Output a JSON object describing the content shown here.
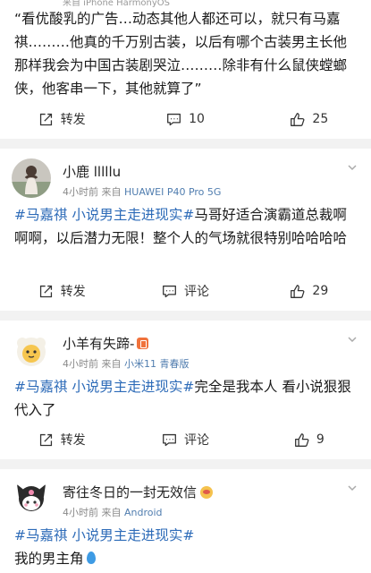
{
  "posts": [
    {
      "cut_meta": "来自 iPhone HarmonyOS",
      "text": "“看优酸乳的广告…动态其他人都还可以，就只有马嘉祺………他真的千万别古装，以后有哪个古装男主长他那样我会为中国古装剧哭泣………除非有什么鼠侠螳螂侠，他客串一下，其他就算了”",
      "repost_label": "转发",
      "comment_count": "10",
      "like_count": "25"
    },
    {
      "username": "小鹿 lllllu",
      "time": "4小时前",
      "source_prefix": "来自",
      "source": "HUAWEI P40 Pro 5G",
      "tag": "#马嘉祺 小说男主走进现实#",
      "text": "马哥好适合演霸道总裁啊啊啊，以后潜力无限！整个人的气场就很特别哈哈哈哈",
      "repost_label": "转发",
      "comment_label": "评论",
      "like_count": "29"
    },
    {
      "username": "小羊有失蹄-",
      "time": "4小时前",
      "source_prefix": "来自",
      "source": "小米11 青春版",
      "tag": "#马嘉祺 小说男主走进现实#",
      "text": "完全是我本人 看小说狠狠代入了",
      "repost_label": "转发",
      "comment_label": "评论",
      "like_count": "9"
    },
    {
      "username": "寄往冬日的一封无效信",
      "time": "4小时前",
      "source_prefix": "来自",
      "source": "Android",
      "tag": "#马嘉祺 小说男主走进现实#",
      "text": "我的男主角"
    }
  ],
  "colors": {
    "topic_blue": "#2d6bb8",
    "meta_gray": "#8a8a8a",
    "background": "#f2f2f2"
  },
  "icons": [
    "repost-icon",
    "comment-icon",
    "like-icon",
    "more-chevron-icon"
  ]
}
